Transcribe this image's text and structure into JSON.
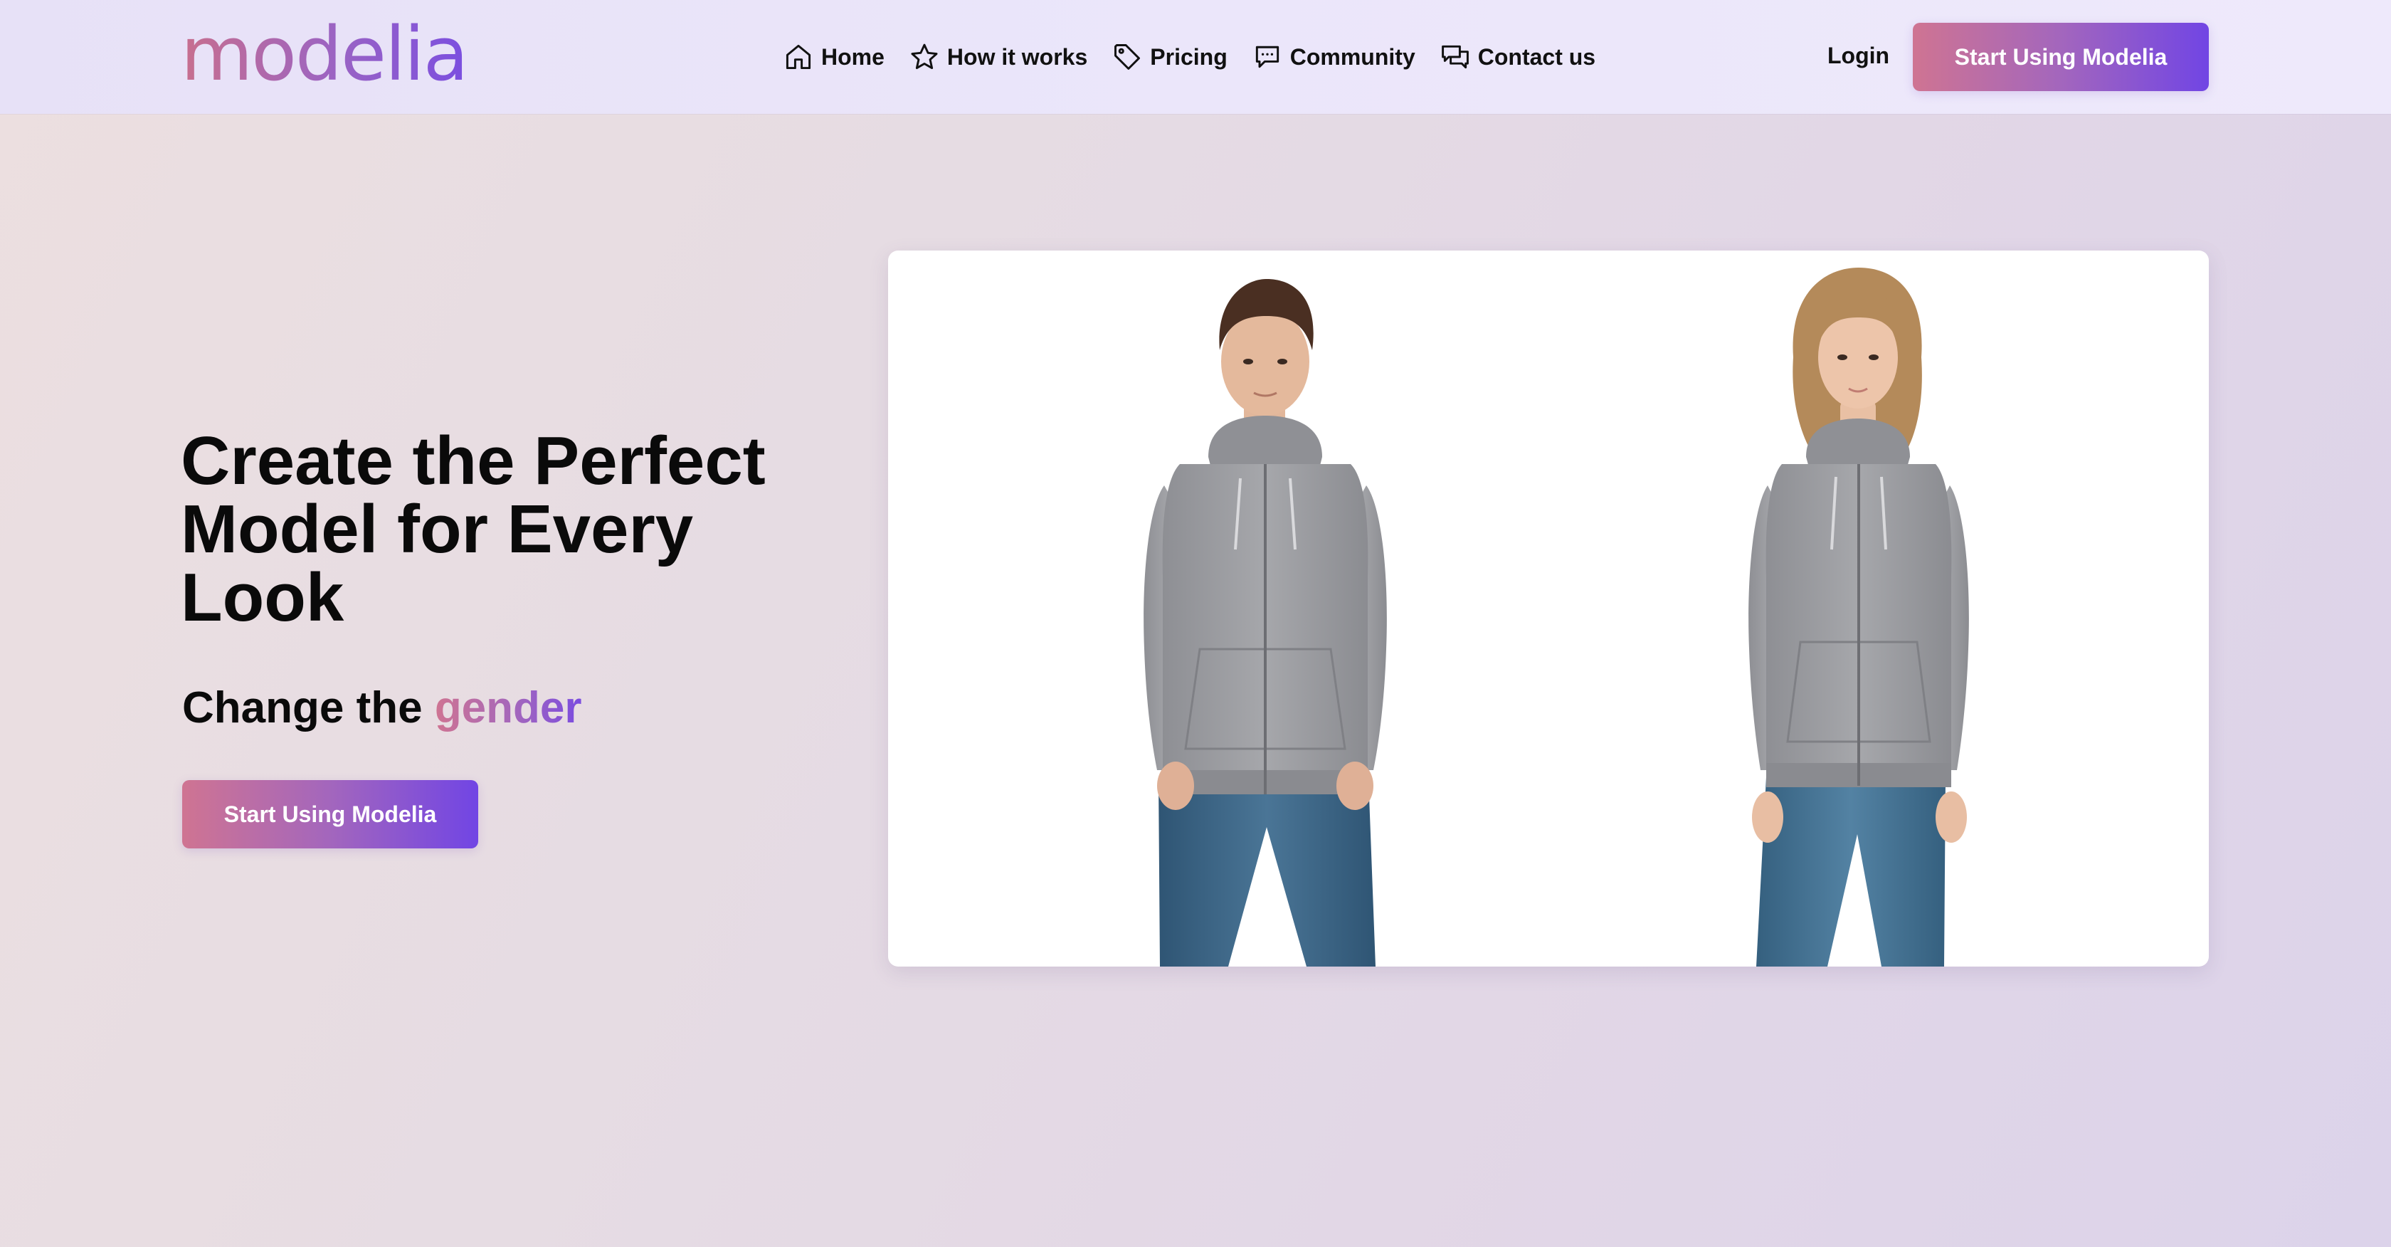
{
  "header": {
    "logo_text": "modelia",
    "nav": [
      {
        "label": "Home",
        "icon": "home-icon"
      },
      {
        "label": "How it works",
        "icon": "star-icon"
      },
      {
        "label": "Pricing",
        "icon": "tag-icon"
      },
      {
        "label": "Community",
        "icon": "chat-icon"
      },
      {
        "label": "Contact us",
        "icon": "chats-icon"
      }
    ],
    "login_label": "Login",
    "cta_label": "Start Using Modelia"
  },
  "hero": {
    "title": "Create the Perfect Model for Every Look",
    "subtitle_prefix": "Change the ",
    "subtitle_accent": "gender",
    "cta_label": "Start Using Modelia"
  },
  "showcase": {
    "models": [
      "male-model-image",
      "female-model-image"
    ]
  },
  "colors": {
    "accent_start": "#cf7492",
    "accent_mid": "#a366bd",
    "accent_end": "#7145e4",
    "navbar_bg": "#ebe6fa",
    "page_bg": "#e6dce3",
    "card_bg": "#ffffff",
    "hoodie": "#9c9da2",
    "jeans": "#3f6a8a"
  }
}
